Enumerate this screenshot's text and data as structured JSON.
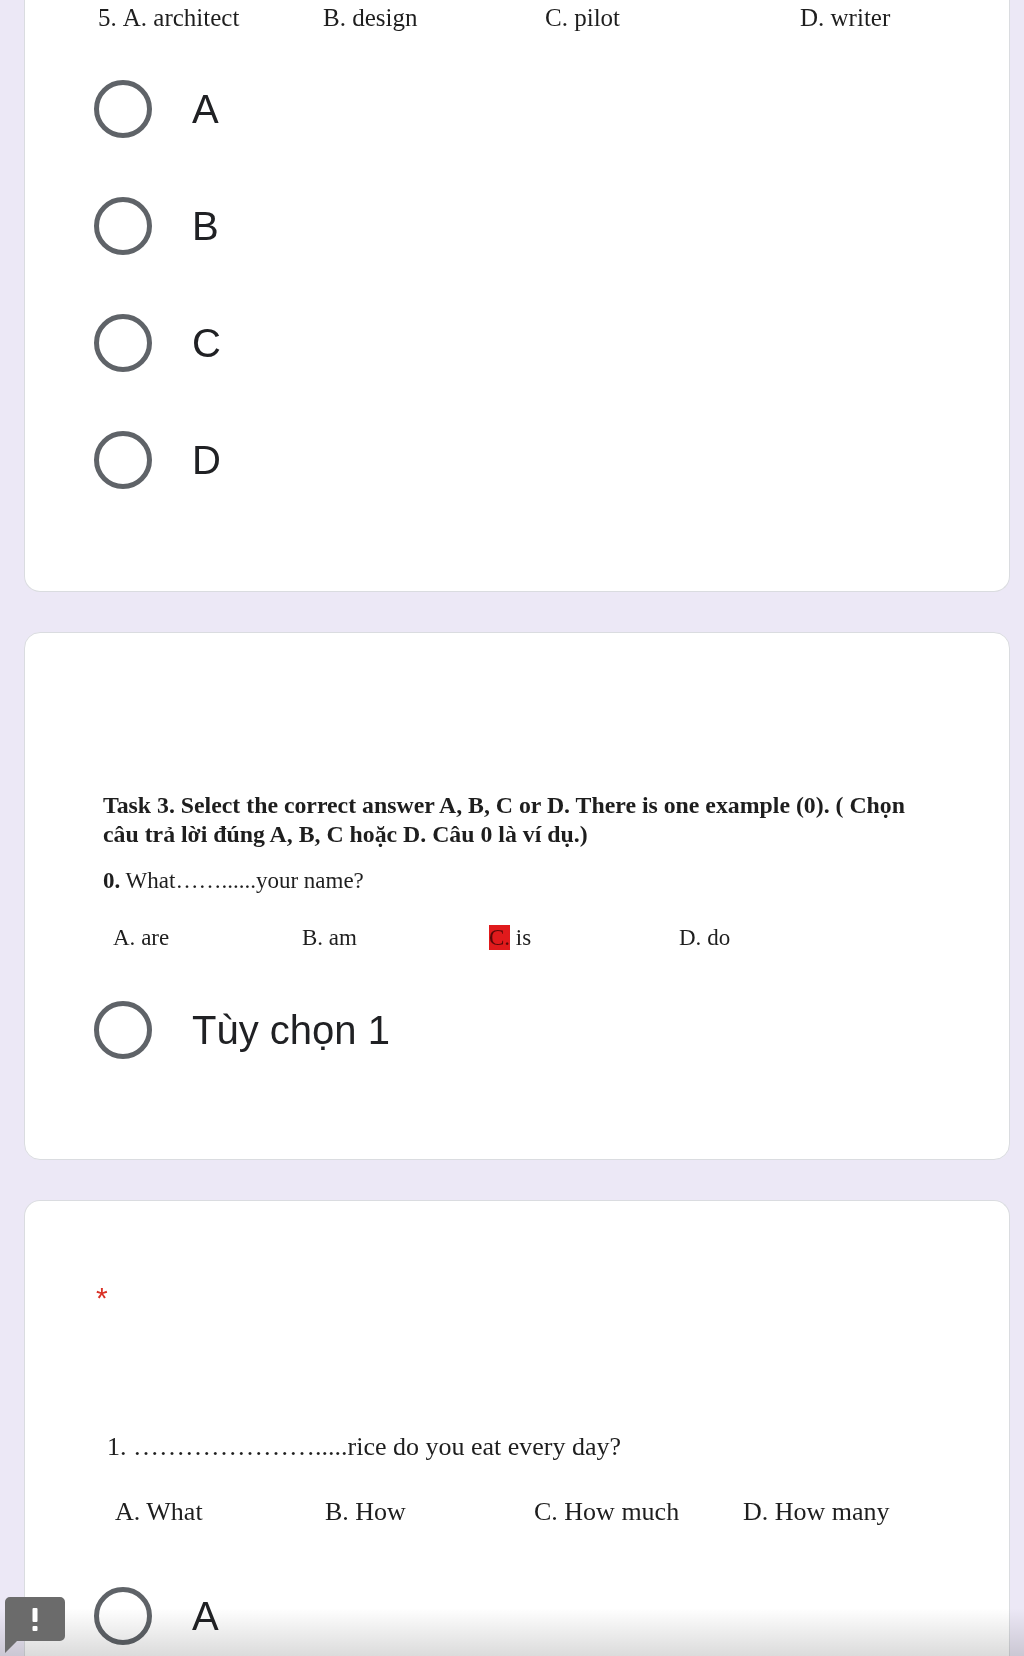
{
  "questions": [
    {
      "content": [
        {
          "kind": "options",
          "number": "5.",
          "options": [
            {
              "letter": "A.",
              "word": "architect",
              "highlighted": false
            },
            {
              "letter": "B.",
              "word": "design",
              "highlighted": false
            },
            {
              "letter": "C.",
              "word": "pilot",
              "highlighted": false
            },
            {
              "letter": "D.",
              "word": "writer",
              "highlighted": false
            }
          ]
        }
      ],
      "choices": [
        {
          "label": "A",
          "selected": false
        },
        {
          "label": "B",
          "selected": false
        },
        {
          "label": "C",
          "selected": false
        },
        {
          "label": "D",
          "selected": false
        }
      ]
    },
    {
      "content": [
        {
          "kind": "instruction",
          "text": "Task 3. Select the correct answer A, B, C or D. There is one example (0). ( Chọn câu trả lời đúng A, B, C hoặc D. Câu 0 là ví dụ.)"
        },
        {
          "kind": "line",
          "text": "**0.** What……......your name?"
        },
        {
          "kind": "options",
          "options": [
            {
              "letter": "A.",
              "word": "are",
              "highlighted": false
            },
            {
              "letter": "B.",
              "word": "am",
              "highlighted": false
            },
            {
              "letter": "C.",
              "word": "is",
              "highlighted": true
            },
            {
              "letter": "D.",
              "word": "do",
              "highlighted": false
            }
          ]
        }
      ],
      "choices": [
        {
          "label": "Tùy chọn 1",
          "selected": false
        }
      ]
    },
    {
      "required_mark": "*",
      "content": [
        {
          "kind": "line",
          "text": "1. ………………….....rice do you eat every day?"
        },
        {
          "kind": "options",
          "options": [
            {
              "letter": "A.",
              "word": "What",
              "highlighted": false
            },
            {
              "letter": "B.",
              "word": "How",
              "highlighted": false
            },
            {
              "letter": "C.",
              "word": "How much",
              "highlighted": false
            },
            {
              "letter": "D.",
              "word": "How many",
              "highlighted": false
            }
          ]
        }
      ],
      "choices": [
        {
          "label": "A",
          "selected": false
        }
      ]
    }
  ]
}
